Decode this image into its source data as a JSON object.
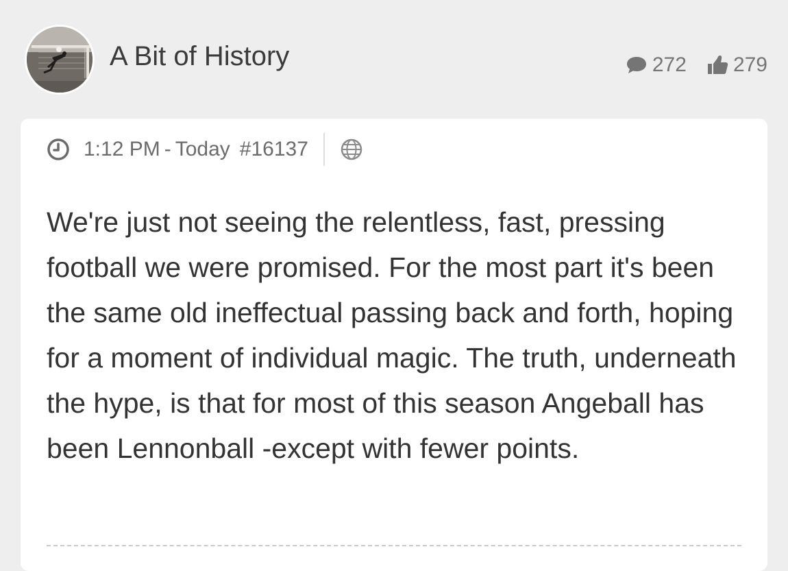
{
  "header": {
    "username": "A Bit of History",
    "comments_count": "272",
    "likes_count": "279"
  },
  "post": {
    "time": "1:12 PM",
    "separator": "-",
    "day": "Today",
    "number": "#16137",
    "body": "We're just not seeing the relentless, fast, pressing football we were promised. For the most part it's been the same old ineffectual passing back and forth, hoping for a moment of individual magic. The truth, underneath the hype, is that for most of this season Angeball has been Lennonball -except with fewer points."
  },
  "icons": {
    "comments": "speech-bubble-icon",
    "likes": "thumbs-up-icon",
    "time": "clock-icon",
    "visibility": "globe-icon"
  },
  "colors": {
    "background": "#eeeeee",
    "card": "#ffffff",
    "text": "#333333",
    "muted": "#757575"
  }
}
